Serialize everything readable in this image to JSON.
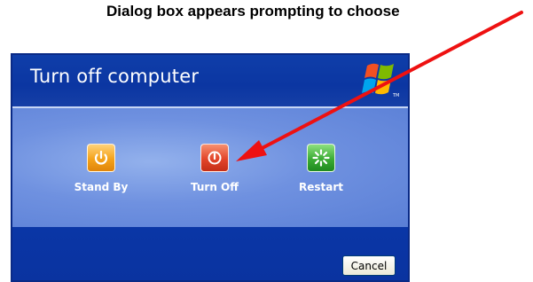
{
  "caption": {
    "text": "Dialog box appears prompting to choose"
  },
  "dialog": {
    "title": "Turn off computer",
    "logo_icon": "windows-xp-flag-icon",
    "options": [
      {
        "label": "Stand By",
        "icon": "standby-power-icon",
        "color": "#f4a21a"
      },
      {
        "label": "Turn Off",
        "icon": "power-icon",
        "color": "#e2452a"
      },
      {
        "label": "Restart",
        "icon": "restart-icon",
        "color": "#3bab34"
      }
    ],
    "cancel_label": "Cancel"
  },
  "annotation": {
    "arrow_color": "#ee1111",
    "target": "Turn Off"
  }
}
